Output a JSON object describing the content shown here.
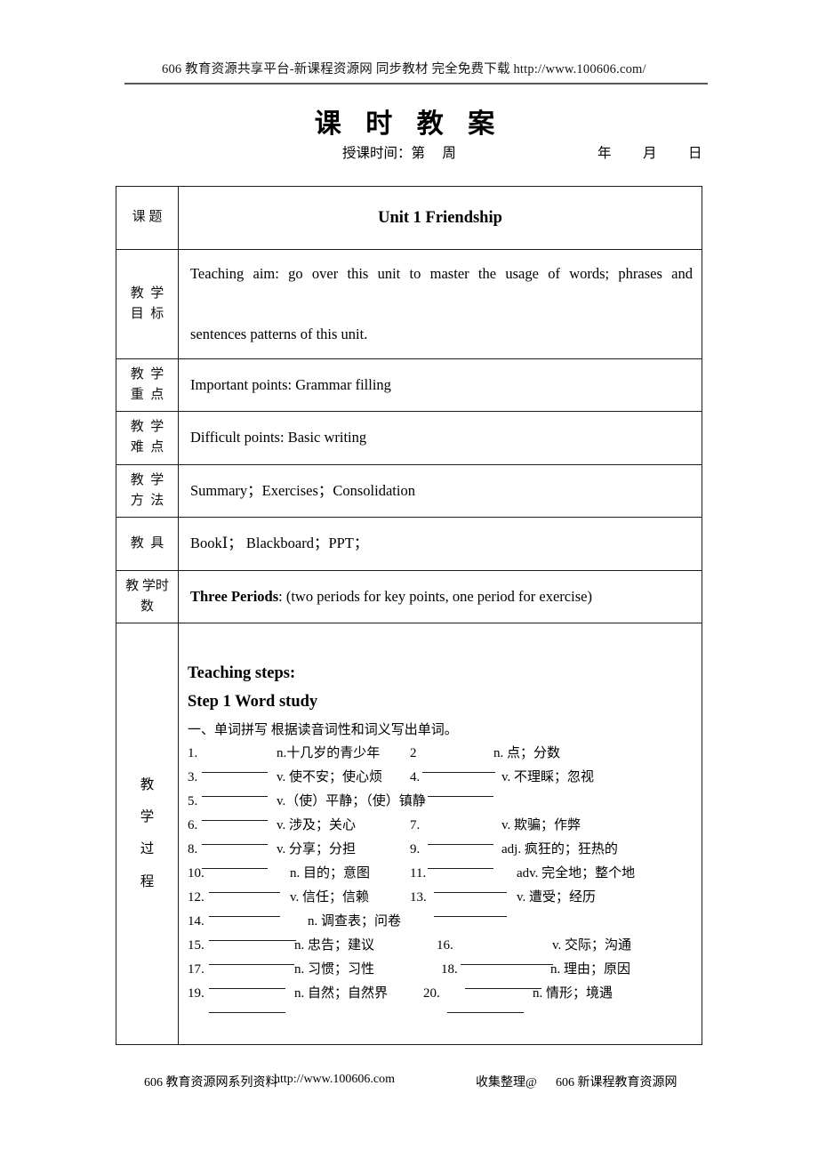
{
  "header": {
    "banner": "606 教育资源共享平台-新课程资源网   同步教材   完全免费下载   http://www.100606.com/"
  },
  "title": "课 时 教 案",
  "subtitle": {
    "left": "授课时间：第     周",
    "year": "年",
    "month": "月",
    "day": "日"
  },
  "table": {
    "rows": [
      {
        "label_lines": [
          "课 题"
        ],
        "value": "Unit 1 Friendship"
      },
      {
        "label_lines": [
          "教  学",
          "目  标"
        ],
        "value_line1": "Teaching aim: go over this unit to master the usage of words; phrases and",
        "value_line2": "sentences patterns of this unit."
      },
      {
        "label_lines": [
          "教  学",
          "重  点"
        ],
        "value": "Important points: Grammar filling"
      },
      {
        "label_lines": [
          "教  学",
          "难  点"
        ],
        "value": "Difficult points:   Basic writing"
      },
      {
        "label_lines": [
          "教  学",
          "方  法"
        ],
        "value": "Summary；Exercises；Consolidation"
      },
      {
        "label_lines": [
          "教  具"
        ],
        "value": "BookⅠ；   Blackboard；PPT；"
      },
      {
        "label_lines": [
          "教 学时",
          "数"
        ],
        "value_bold": "Three Periods",
        "value_rest": ": (two periods for key points, one period for exercise)"
      }
    ],
    "process": {
      "label_chars": [
        "教",
        "学",
        "过",
        "程"
      ],
      "heading_line1": "Teaching steps:",
      "heading_line2": "Step 1 Word study",
      "instruction": "一、单词拼写 根据读音词性和词义写出单词。",
      "words": [
        {
          "num": "1.",
          "def": "n.十几岁的青少年",
          "num2": "2",
          "def2": "n. 点；分数"
        },
        {
          "num": "3.",
          "def": "v. 使不安；使心烦",
          "num2": "4.",
          "def2": "v. 不理睬；忽视"
        },
        {
          "num": "5.",
          "def": "v.（使）平静；（使）镇静",
          "num2": "",
          "def2": ""
        },
        {
          "num": "6.",
          "def": "v. 涉及；关心",
          "num2": "7.",
          "def2": "v. 欺骗；作弊"
        },
        {
          "num": "8.",
          "def": "v. 分享；分担",
          "num2": "9.",
          "def2": "adj. 疯狂的；狂热的"
        },
        {
          "num": "10.",
          "def": "n. 目的；意图",
          "num2": "11.",
          "def2": "adv. 完全地；整个地"
        },
        {
          "num": "12.",
          "def": "v. 信任；信赖",
          "num2": "13.",
          "def2": "v. 遭受；经历"
        },
        {
          "num": "14.",
          "def": "n. 调查表；问卷",
          "num2": "",
          "def2": ""
        },
        {
          "num": "15.",
          "def": "n. 忠告；建议",
          "num2": "16.",
          "def2": "v. 交际；沟通"
        },
        {
          "num": "17.",
          "def": "n. 习惯；习性",
          "num2": "18.",
          "def2": "n. 理由；原因"
        },
        {
          "num": "19.",
          "def": "n. 自然；自然界",
          "num2": "20.",
          "def2": "n. 情形；境遇"
        }
      ]
    }
  },
  "footer": {
    "left": "606 教育资源网系列资料",
    "url": "http://www.100606.com",
    "middle": "收集整理@",
    "right": "606 新课程教育资源网"
  }
}
